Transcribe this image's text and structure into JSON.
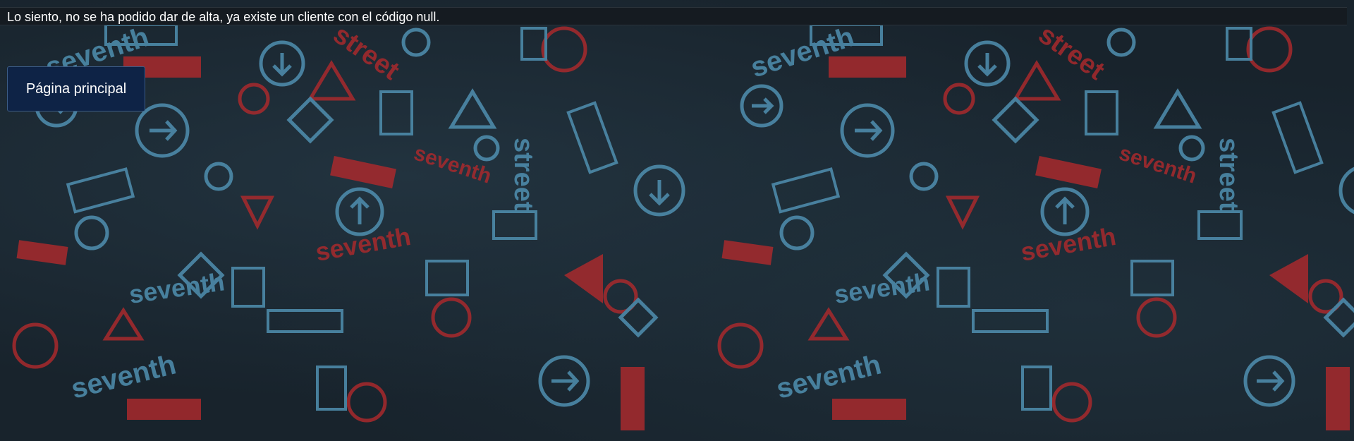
{
  "message": {
    "text": "Lo siento, no se ha podido dar de alta, ya existe un cliente con el código null."
  },
  "home_button": {
    "label": "Página principal"
  },
  "background": {
    "icon": "road-signs-pattern",
    "colors": {
      "base": "#18232c",
      "blue": "#4f8fb0",
      "red": "#a8292c"
    }
  }
}
